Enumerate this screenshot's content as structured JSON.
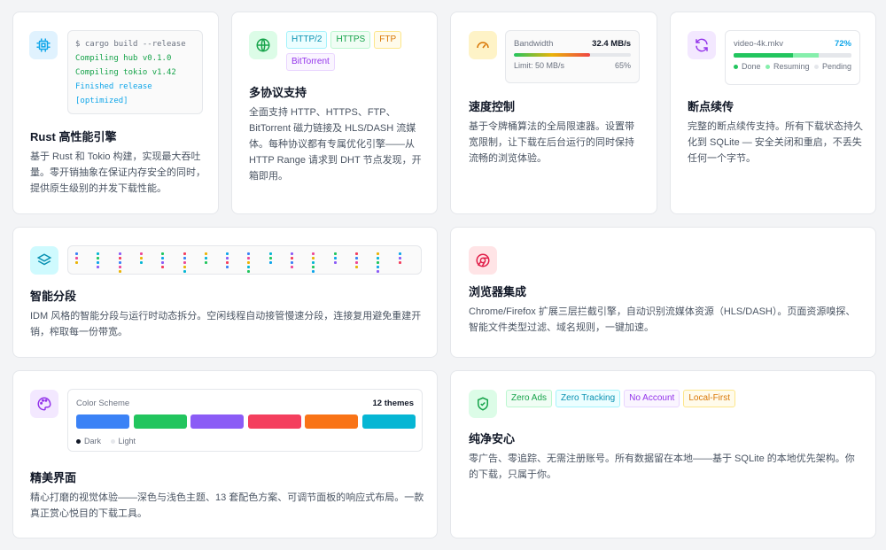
{
  "cards": {
    "rust": {
      "title": "Rust 高性能引擎",
      "desc": "基于 Rust 和 Tokio 构建，实现最大吞吐量。零开销抽象在保证内存安全的同时，提供原生级别的并发下载性能。",
      "terminal": [
        {
          "text": "$ cargo build --release",
          "color": "#6b7280"
        },
        {
          "text": "Compiling hub v0.1.0",
          "color": "#16a34a"
        },
        {
          "text": "Compiling tokio v1.42",
          "color": "#16a34a"
        },
        {
          "text": "Finished release",
          "color": "#0ea5e9"
        },
        {
          "text": "[optimized]",
          "color": "#0ea5e9"
        }
      ]
    },
    "protocols": {
      "title": "多协议支持",
      "desc": "全面支持 HTTP、HTTPS、FTP、BitTorrent 磁力链接及 HLS/DASH 流媒体。每种协议都有专属优化引擎——从 HTTP Range 请求到 DHT 节点发现，开箱即用。",
      "tags": [
        {
          "label": "HTTP/2",
          "color": "#0891b2",
          "bg": "#ecfeff",
          "border": "#a5f3fc"
        },
        {
          "label": "HTTPS",
          "color": "#16a34a",
          "bg": "#f0fdf4",
          "border": "#bbf7d0"
        },
        {
          "label": "FTP",
          "color": "#d97706",
          "bg": "#fffbeb",
          "border": "#fde68a"
        },
        {
          "label": "BitTorrent",
          "color": "#9333ea",
          "bg": "#faf5ff",
          "border": "#e9d5ff"
        }
      ]
    },
    "speed": {
      "title": "速度控制",
      "desc": "基于令牌桶算法的全局限速器。设置带宽限制，让下载在后台运行的同时保持流畅的浏览体验。",
      "bandwidth_label": "Bandwidth",
      "bandwidth_value": "32.4 MB/s",
      "limit_label": "Limit: 50 MB/s",
      "percent_label": "65%",
      "fill_fraction": 0.65
    },
    "resume": {
      "title": "断点续传",
      "desc": "完整的断点续传支持。所有下载状态持久化到 SQLite — 安全关闭和重启，不丢失任何一个字节。",
      "filename": "video-4k.mkv",
      "percent_label": "72%",
      "done_fraction": 0.5,
      "resuming_fraction": 0.22,
      "legend": [
        {
          "label": "Done",
          "color": "#22c55e"
        },
        {
          "label": "Resuming",
          "color": "#86efac"
        },
        {
          "label": "Pending",
          "color": "#e5e7eb"
        }
      ]
    },
    "segment": {
      "title": "智能分段",
      "desc": "IDM 风格的智能分段与运行时动态拆分。空闲线程自动接管慢速分段，连接复用避免重建开销，榨取每一份带宽。"
    },
    "browser": {
      "title": "浏览器集成",
      "desc": "Chrome/Firefox 扩展三层拦截引擎，自动识别流媒体资源（HLS/DASH）。页面资源嗅探、智能文件类型过滤、域名规则，一键加速。"
    },
    "ui": {
      "title": "精美界面",
      "desc": "精心打磨的视觉体验——深色与浅色主题、13 套配色方案、可调节面板的响应式布局。一款真正赏心悦目的下载工具。",
      "scheme_label": "Color Scheme",
      "themes_label": "12 themes",
      "swatches": [
        "#3b82f6",
        "#22c55e",
        "#8b5cf6",
        "#f43f5e",
        "#f97316",
        "#06b6d4"
      ],
      "dark_label": "Dark",
      "light_label": "Light"
    },
    "privacy": {
      "title": "纯净安心",
      "desc": "零广告、零追踪、无需注册账号。所有数据留在本地——基于 SQLite 的本地优先架构。你的下载，只属于你。",
      "tags": [
        {
          "label": "Zero Ads",
          "color": "#16a34a",
          "bg": "#f0fdf4",
          "border": "#bbf7d0"
        },
        {
          "label": "Zero Tracking",
          "color": "#0891b2",
          "bg": "#ecfeff",
          "border": "#a5f3fc"
        },
        {
          "label": "No Account",
          "color": "#9333ea",
          "bg": "#faf5ff",
          "border": "#e9d5ff"
        },
        {
          "label": "Local-First",
          "color": "#d97706",
          "bg": "#fffbeb",
          "border": "#fde68a"
        }
      ]
    }
  },
  "colors": {
    "rust_icon": "#0ea5e9",
    "protocol_icon": "#16a34a",
    "speed_icon": "#d97706",
    "resume_icon": "#9333ea",
    "segment_icon": "#0891b2",
    "browser_icon": "#e11d48",
    "ui_icon": "#9333ea",
    "privacy_icon": "#16a34a"
  }
}
